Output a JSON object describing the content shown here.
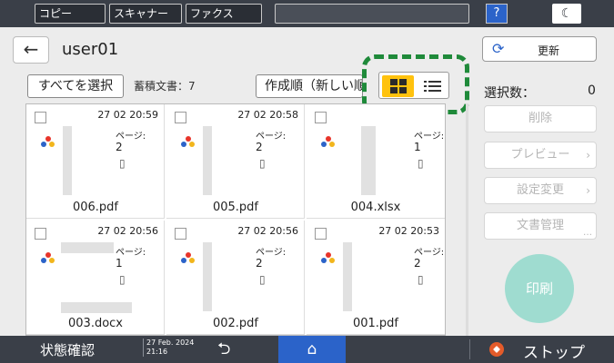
{
  "topbar": {
    "tabs": [
      "コピー",
      "スキャナー",
      "ファクス"
    ],
    "help_label": "?",
    "night_mode_label": "☾"
  },
  "header": {
    "back_label": "←",
    "user": "user01",
    "refresh_label": "更新"
  },
  "toolbar": {
    "select_all_label": "すべてを選択",
    "stored_docs": "蓄積文書：7",
    "sort_label": "作成順（新しい順）",
    "view_mode": "grid"
  },
  "documents": [
    {
      "date": "27 02  20:59",
      "page_label": "ページ:",
      "pages": "2",
      "filename": "006.pdf"
    },
    {
      "date": "27 02  20:58",
      "page_label": "ページ:",
      "pages": "2",
      "filename": "005.pdf"
    },
    {
      "date": "",
      "page_label": "ページ:",
      "pages": "1",
      "filename": "004.xlsx"
    },
    {
      "date": "27 02  20:56",
      "page_label": "ページ:",
      "pages": "1",
      "filename": "003.docx"
    },
    {
      "date": "27 02  20:56",
      "page_label": "ページ:",
      "pages": "2",
      "filename": "002.pdf"
    },
    {
      "date": "27 02  20:53",
      "page_label": "ページ:",
      "pages": "2",
      "filename": "001.pdf"
    }
  ],
  "right_panel": {
    "selected_label": "選択数：",
    "selected_count": "0",
    "delete_label": "削除",
    "preview_label": "プレビュー",
    "settings_label": "設定変更",
    "doc_manage_label": "文書管理",
    "print_label": "印刷"
  },
  "bottombar": {
    "status_label": "状態確認",
    "date_line1": "27 Feb. 2024",
    "date_line2": "21:16",
    "stop_label": "ストップ"
  },
  "colors": {
    "accent_blue": "#2b63c9",
    "highlight_green": "#1f8a3a",
    "grid_toggle_yellow": "#ffc20e",
    "print_teal": "#9fdcd0",
    "stop_orange": "#e45b2a"
  }
}
